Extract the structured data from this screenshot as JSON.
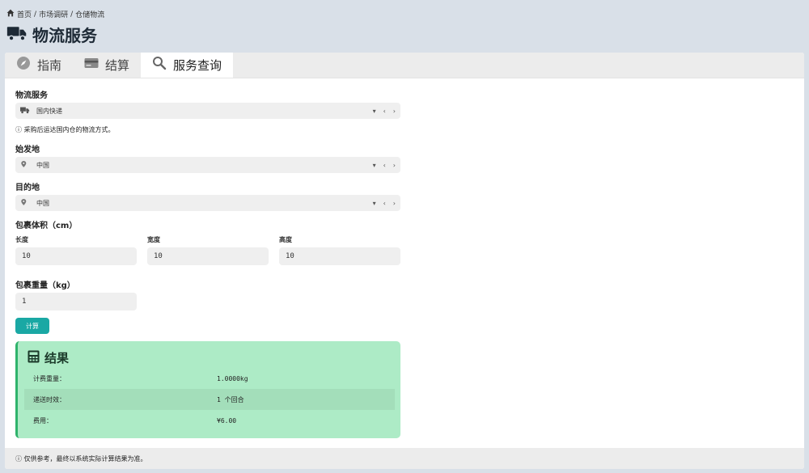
{
  "breadcrumb": {
    "home": "首页",
    "sep": "/",
    "level2": "市场调研",
    "level3": "仓储物流"
  },
  "page": {
    "title": "物流服务"
  },
  "tabs": [
    {
      "label": "指南",
      "icon": "compass-icon"
    },
    {
      "label": "结算",
      "icon": "credit-card-icon"
    },
    {
      "label": "服务查询",
      "icon": "search-icon"
    }
  ],
  "form": {
    "service": {
      "label": "物流服务",
      "value": "国内快递",
      "hint": "ⓘ 采购后运达国内仓的物流方式。"
    },
    "origin": {
      "label": "始发地",
      "value": "中国"
    },
    "destination": {
      "label": "目的地",
      "value": "中国"
    },
    "volume": {
      "label": "包裹体积（cm）",
      "length": {
        "label": "长度",
        "value": "10"
      },
      "width": {
        "label": "宽度",
        "value": "10"
      },
      "height": {
        "label": "高度",
        "value": "10"
      }
    },
    "weight": {
      "label": "包裹重量（kg）",
      "value": "1"
    },
    "submit": "计算"
  },
  "result": {
    "title": "结果",
    "rows": [
      {
        "key": "计费重量：",
        "value": "1.0000kg"
      },
      {
        "key": "递送时效：",
        "value": "1 个回合"
      },
      {
        "key": "费用：",
        "value": "¥6.00"
      }
    ]
  },
  "footer": {
    "note": "ⓘ 仅供参考，最终以系统实际计算结果为准。"
  },
  "colors": {
    "accent": "#1aa8a4",
    "result_bg": "#adebc6",
    "result_border": "#2fb36b"
  }
}
